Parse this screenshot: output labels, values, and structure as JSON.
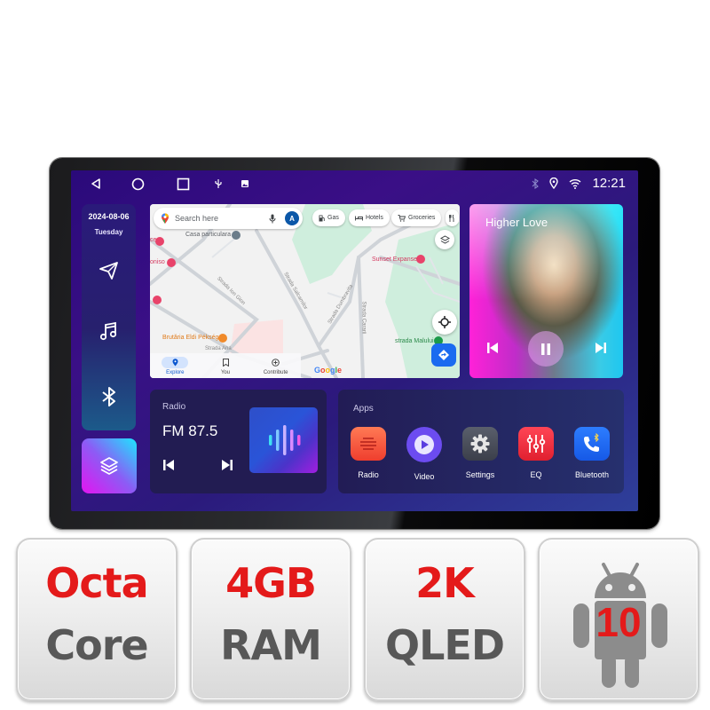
{
  "statusbar": {
    "nav": [
      {
        "name": "back",
        "icon": "back-triangle-icon"
      },
      {
        "name": "home",
        "icon": "home-circle-icon"
      },
      {
        "name": "recents",
        "icon": "recents-square-icon"
      }
    ],
    "indicators": [
      "usb-icon",
      "image-icon"
    ],
    "status_icons": [
      "bluetooth-icon",
      "location-icon",
      "wifi-icon"
    ],
    "time": "12:21"
  },
  "rail": {
    "date": "2024-08-06",
    "day": "Tuesday",
    "items": [
      {
        "name": "navigation",
        "icon": "navigation-arrow-icon"
      },
      {
        "name": "music",
        "icon": "music-note-icon"
      },
      {
        "name": "bluetooth",
        "icon": "bluetooth-icon"
      },
      {
        "name": "apps-layers",
        "icon": "layers-icon",
        "active": true
      }
    ]
  },
  "map": {
    "search_placeholder": "Search here",
    "avatar_letter": "A",
    "chips": [
      "Gas",
      "Hotels",
      "Groceries"
    ],
    "places": {
      "casa": "Casa particulara",
      "sunset": "Sunset Expanse",
      "brutaria": "Brutăria Eldi Pékség",
      "strada_malului": "strada Malului",
      "strada_ion": "Strada Ion Gion",
      "strada_salcamilor": "Strada Salcamilor",
      "strada_dumbravita": "Strada Dumbravita",
      "strada_cararii": "Strada Cararii",
      "strada_ana": "Strada Ana",
      "partial_ce": "ce",
      "partial_oniso": "oniso"
    },
    "tabs": [
      {
        "label": "Explore",
        "active": true
      },
      {
        "label": "You",
        "active": false
      },
      {
        "label": "Contribute",
        "active": false
      }
    ],
    "brand": "Google"
  },
  "music": {
    "title": "Higher Love",
    "state": "playing"
  },
  "radio": {
    "label": "Radio",
    "frequency": "FM 87.5"
  },
  "apps": {
    "label": "Apps",
    "items": [
      {
        "label": "Radio",
        "color": "#f4533a"
      },
      {
        "label": "Video",
        "color": "#6c4cf0"
      },
      {
        "label": "Settings",
        "color": "#4a4f5c"
      },
      {
        "label": "EQ",
        "color": "#ef2e3f"
      },
      {
        "label": "Bluetooth",
        "color": "#1f6bf5"
      }
    ]
  },
  "specs": [
    {
      "top": "Octa",
      "bottom": "Core"
    },
    {
      "top": "4GB",
      "bottom": "RAM"
    },
    {
      "top": "2K",
      "bottom": "QLED"
    },
    {
      "os_version": "10",
      "icon": "android-robot-icon"
    }
  ],
  "colors": {
    "spec_accent": "#e41a1a",
    "spec_text": "#585858",
    "active_rail_gradient": [
      "#e414f0",
      "#1de6ff"
    ]
  }
}
